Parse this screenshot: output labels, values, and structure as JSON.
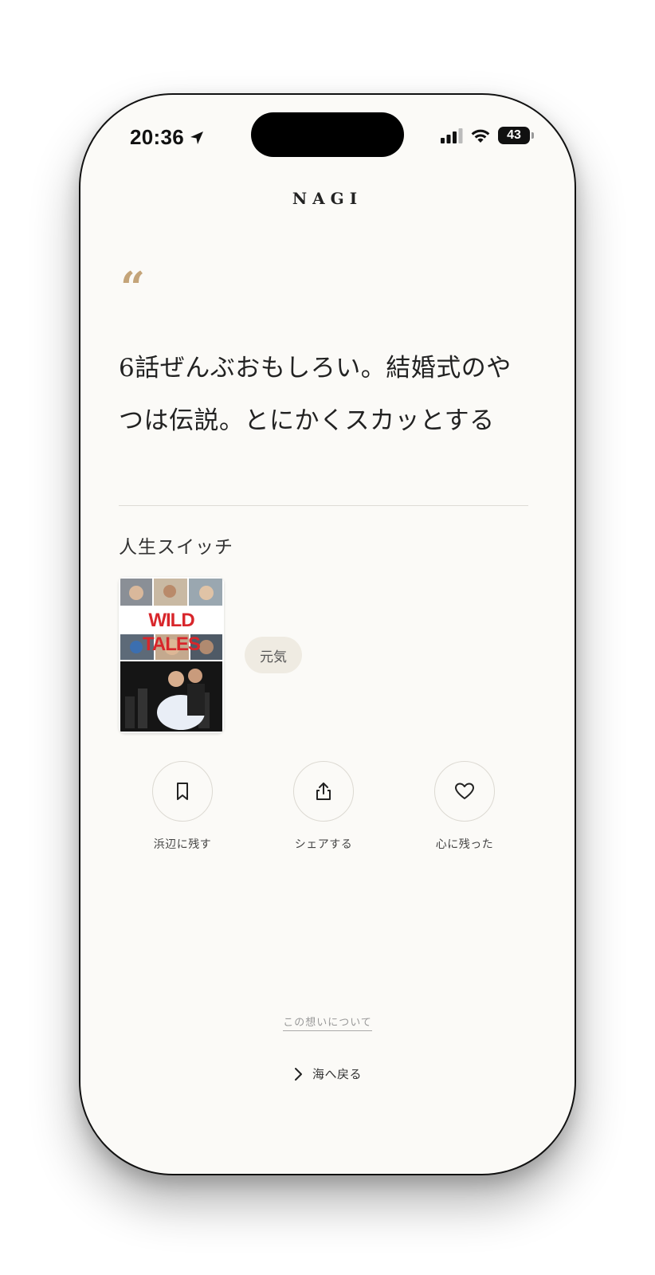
{
  "status_bar": {
    "time": "20:36",
    "battery": "43",
    "icons": [
      "location-arrow-icon",
      "cellular-signal-icon",
      "wifi-icon",
      "battery-icon"
    ]
  },
  "header": {
    "brand": "NAGI"
  },
  "quote": {
    "mark": "“",
    "text": "6話ぜんぶおもしろい。結婚式のやつは伝説。とにかくスカッとする"
  },
  "work": {
    "title": "人生スイッチ",
    "poster_title": "WILD TALES",
    "tag": "元気"
  },
  "actions": [
    {
      "label": "浜辺に残す",
      "icon": "bookmark-icon"
    },
    {
      "label": "シェアする",
      "icon": "share-icon"
    },
    {
      "label": "心に残った",
      "icon": "heart-icon"
    }
  ],
  "footer": {
    "about_label": "この想いについて",
    "back_label": "海へ戻る"
  },
  "colors": {
    "background": "#fbfaf7",
    "accent_gold": "#c4a479",
    "tag_background": "#efebe2",
    "poster_red": "#d8262b"
  }
}
